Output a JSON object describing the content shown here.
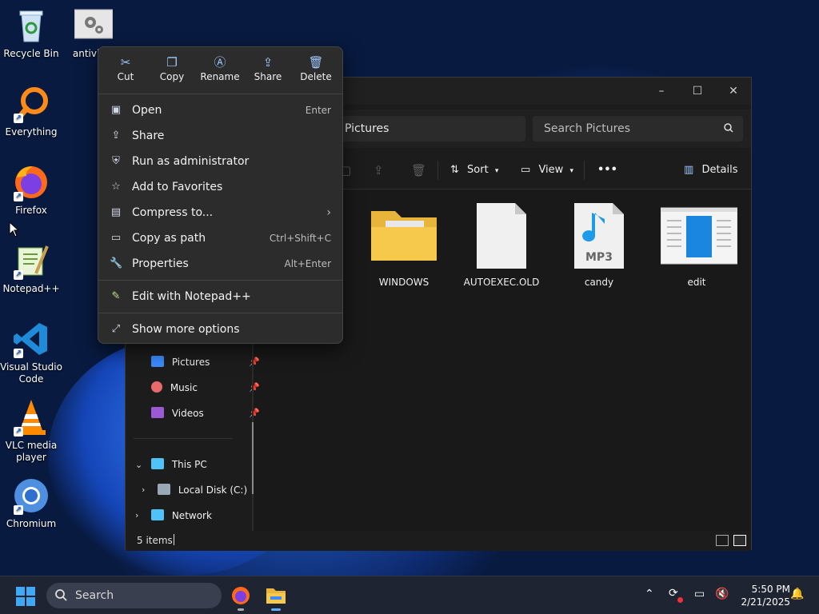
{
  "desktop": {
    "icons": [
      {
        "label": "Recycle Bin"
      },
      {
        "label": "antivirus"
      },
      {
        "label": "Everything"
      },
      {
        "label": "Firefox"
      },
      {
        "label": "Notepad++"
      },
      {
        "label": "Visual Studio Code"
      },
      {
        "label": "VLC media player"
      },
      {
        "label": "Chromium"
      }
    ]
  },
  "context_menu": {
    "quick_actions": [
      {
        "label": "Cut",
        "icon": "scissors-icon"
      },
      {
        "label": "Copy",
        "icon": "copy-icon"
      },
      {
        "label": "Rename",
        "icon": "rename-icon"
      },
      {
        "label": "Share",
        "icon": "share-icon"
      },
      {
        "label": "Delete",
        "icon": "trash-icon"
      }
    ],
    "items": [
      {
        "label": "Open",
        "shortcut": "Enter"
      },
      {
        "label": "Share",
        "shortcut": ""
      },
      {
        "label": "Run as administrator",
        "shortcut": ""
      },
      {
        "label": "Add to Favorites",
        "shortcut": ""
      },
      {
        "label": "Compress to...",
        "shortcut": ""
      },
      {
        "label": "Copy as path",
        "shortcut": "Ctrl+Shift+C"
      },
      {
        "label": "Properties",
        "shortcut": "Alt+Enter"
      }
    ],
    "extra": {
      "label": "Edit with Notepad++"
    },
    "more": {
      "label": "Show more options"
    }
  },
  "explorer": {
    "address": "Pictures",
    "search_placeholder": "Search Pictures",
    "toolbar": {
      "sort": "Sort",
      "view": "View",
      "more": "•••",
      "details": "Details"
    },
    "nav": {
      "pictures": "Pictures",
      "music": "Music",
      "videos": "Videos",
      "this_pc": "This PC",
      "local_disk": "Local Disk (C:)",
      "network": "Network"
    },
    "files": [
      {
        "name": "WINDOWS",
        "type": "folder"
      },
      {
        "name": "AUTOEXEC.OLD",
        "type": "file"
      },
      {
        "name": "candy",
        "type": "mp3",
        "badge": "MP3"
      },
      {
        "name": "edit",
        "type": "app"
      }
    ],
    "status": "5 items"
  },
  "taskbar": {
    "search_label": "Search",
    "time": "5:50 PM",
    "date": "2/21/2025"
  },
  "colors": {
    "accent": "#3b8bff",
    "folder": "#f6c94c"
  }
}
